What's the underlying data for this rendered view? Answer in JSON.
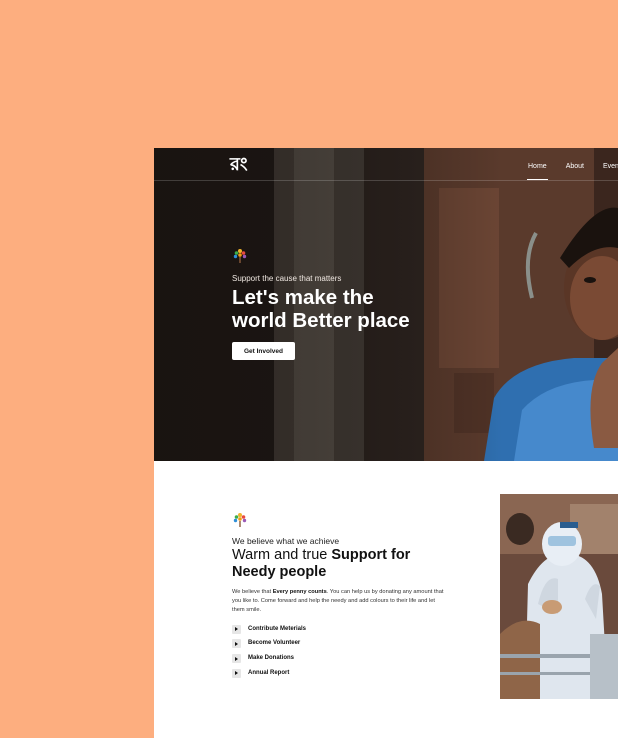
{
  "hero": {
    "logo": "রং",
    "nav": [
      "Home",
      "About",
      "Even"
    ],
    "kicker": "Support the cause that matters",
    "title_line1": "Let's make the",
    "title_line2": "world Better place",
    "cta": "Get Involved"
  },
  "about": {
    "kicker": "We believe what we achieve",
    "title_normal": "Warm and true ",
    "title_bold_1": "Support for",
    "title_bold_2": "Needy people",
    "body_prefix": "We believe that ",
    "body_bold": "Every penny counts",
    "body_suffix": ". You can help us by donating any amount that you like to. Come forward and help the needy and add colours to their life and let them smile.",
    "links": [
      "Contribute Meterials",
      "Become Volunteer",
      "Make Donations",
      "Annual Report"
    ]
  },
  "colors": {
    "background": "#FDAE7F",
    "hero_dark": "#2b211c",
    "accent_white": "#ffffff"
  }
}
